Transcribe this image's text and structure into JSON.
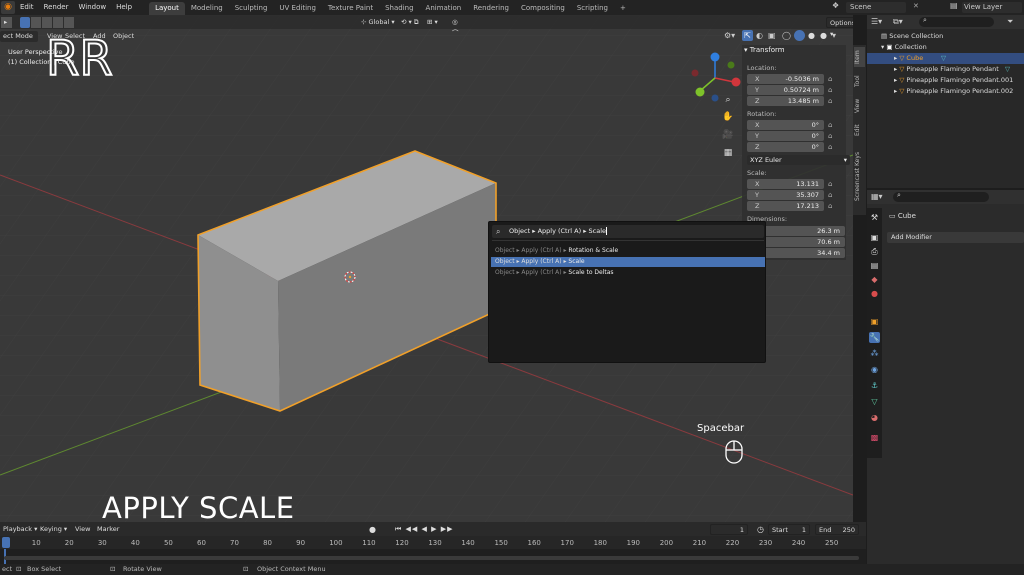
{
  "menu": [
    "Edit",
    "Render",
    "Window",
    "Help"
  ],
  "workspaces": [
    "Layout",
    "Modeling",
    "Sculpting",
    "UV Editing",
    "Texture Paint",
    "Shading",
    "Animation",
    "Rendering",
    "Compositing",
    "Scripting"
  ],
  "scene_name": "Scene",
  "view_layer": "View Layer",
  "viewport": {
    "mode": "ect Mode",
    "menus": [
      "View",
      "Select",
      "Add",
      "Object"
    ],
    "orientation": "Global",
    "options": "Options",
    "perspective_label": "User Perspective",
    "collection_label": "(1) Collection | Cube"
  },
  "npanel": {
    "section": "Transform",
    "location_label": "Location:",
    "location": [
      {
        "axis": "X",
        "value": "-0.5036 m"
      },
      {
        "axis": "Y",
        "value": "0.50724 m"
      },
      {
        "axis": "Z",
        "value": "13.485 m"
      }
    ],
    "rotation_label": "Rotation:",
    "rotation": [
      {
        "axis": "X",
        "value": "0°"
      },
      {
        "axis": "Y",
        "value": "0°"
      },
      {
        "axis": "Z",
        "value": "0°"
      }
    ],
    "rotation_mode": "XYZ Euler",
    "scale_label": "Scale:",
    "scale": [
      {
        "axis": "X",
        "value": "13.131"
      },
      {
        "axis": "Y",
        "value": "35.307"
      },
      {
        "axis": "Z",
        "value": "17.213"
      }
    ],
    "dimensions_label": "Dimensions:",
    "dimensions": [
      "26.3 m",
      "70.6 m",
      "34.4 m"
    ],
    "tabs": [
      "Item",
      "Tool",
      "View",
      "Edit",
      "Screencast Keys"
    ]
  },
  "search_popup": {
    "query": "Object ▸ Apply (Ctrl A) ▸ Scale",
    "results": [
      {
        "prefix": "Object ▸ Apply (Ctrl A) ▸ ",
        "name": "Rotation & Scale",
        "selected": false
      },
      {
        "prefix": "Object ▸ Apply (Ctrl A) ▸ ",
        "name": "Scale",
        "selected": true
      },
      {
        "prefix": "Object ▸ Apply (Ctrl A) ▸ ",
        "name": "Scale to Deltas",
        "selected": false
      }
    ]
  },
  "outliner": {
    "scene_collection": "Scene Collection",
    "collection": "Collection",
    "objects": [
      "Cube",
      "Pineapple Flamingo Pendant",
      "Pineapple Flamingo Pendant.001",
      "Pineapple Flamingo Pendant.002"
    ]
  },
  "properties": {
    "object_name": "Cube",
    "add_modifier": "Add Modifier"
  },
  "overlay": {
    "title": "APPLY SCALE",
    "key_hint": "Spacebar"
  },
  "timeline": {
    "menus": [
      "Playback",
      "Keying",
      "View",
      "Marker"
    ],
    "current_frame": "1",
    "start_label": "Start",
    "start": "1",
    "end_label": "End",
    "end": "250",
    "ticks": [
      "1",
      "10",
      "20",
      "30",
      "40",
      "50",
      "60",
      "70",
      "80",
      "90",
      "100",
      "110",
      "120",
      "130",
      "140",
      "150",
      "160",
      "170",
      "180",
      "190",
      "200",
      "210",
      "220",
      "230",
      "240",
      "250"
    ]
  },
  "statusbar": {
    "select": "ect",
    "box_select": "Box Select",
    "rotate_view": "Rotate View",
    "context_menu": "Object Context Menu"
  },
  "colors": {
    "accent": "#4772b3",
    "selection_orange": "#f0a02a",
    "axis_x": "#d2363c",
    "axis_y": "#7ec22a",
    "axis_z": "#2f7fe0"
  }
}
